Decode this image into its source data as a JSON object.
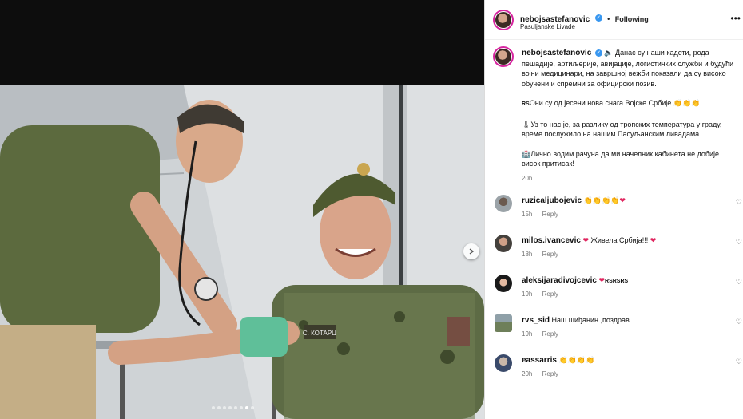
{
  "post": {
    "username": "nebojsastefanovic",
    "follow_status": "Following",
    "location": "Pasuljanske Livade",
    "caption": {
      "line1_text": "Данас су наши кадети, рода пешадије, артиљерије, авијације, логистичких служби и будући војни медицинари, на завршној вежби показали да су високо обучени и спремни за официрски позив.",
      "line2_prefix": "RS",
      "line2_text": "Они су од јесени нова снага Војске Србије",
      "line2_emoji": "👏👏👏",
      "line3_text": "Уз то нас је, за разлику од тропских температура у граду, време послужило на нашим Пасуљанским ливадама.",
      "line4_text": "Лично водим рачуна да ми начелник кабинета не добије висок притисак!",
      "time": "20h"
    },
    "media": {
      "carousel_dots": 8,
      "active_dot": 6,
      "nametape": "С. КОТАРЦ"
    }
  },
  "comments": [
    {
      "username": "ruzicaljubojevic",
      "text": "👏👏👏👏",
      "suffix": "❤",
      "time": "15h",
      "reply": "Reply"
    },
    {
      "username": "milos.ivancevic",
      "prefix": "❤",
      "text": "Живела Србија!!!",
      "suffix": "❤",
      "time": "18h",
      "reply": "Reply"
    },
    {
      "username": "aleksijaradivojcevic",
      "prefix": "❤",
      "text": "RSRSRS",
      "suffix": "",
      "time": "19h",
      "reply": "Reply"
    },
    {
      "username": "rvs_sid",
      "text": "Наш шиђанин ,поздрав",
      "suffix": "",
      "time": "19h",
      "reply": "Reply"
    },
    {
      "username": "eassarris",
      "text": "👏👏👏👏",
      "suffix": "",
      "time": "20h",
      "reply": "Reply"
    }
  ],
  "colors": {
    "verified": "#3897f0",
    "heart": "#e0245e",
    "story_ring": "#d6249f",
    "muted_text": "#737373"
  },
  "icons": {
    "verified": "check-badge",
    "more": "ellipsis",
    "speaker": "speaker-emoji",
    "next": "chevron-right"
  }
}
